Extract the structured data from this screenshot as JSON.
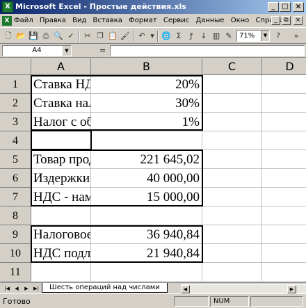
{
  "window": {
    "title": "Microsoft Excel - Простые действия.xls",
    "minimize": "_",
    "maximize": "□",
    "close": "×"
  },
  "menu": {
    "items": [
      "Файл",
      "Правка",
      "Вид",
      "Вставка",
      "Формат",
      "Сервис",
      "Данные",
      "Окно",
      "Справка"
    ],
    "mdi_min": "_",
    "mdi_restore": "⧉",
    "mdi_close": "×"
  },
  "toolbar": {
    "zoom": "71%"
  },
  "formula": {
    "namebox": "A4",
    "eq": "=",
    "value": ""
  },
  "columns": [
    "A",
    "B",
    "C",
    "D"
  ],
  "rows": [
    {
      "num": "1",
      "a": "Ставка НДС",
      "b": "20%"
    },
    {
      "num": "2",
      "a": "Ставка налога на прибыль",
      "b": "30%"
    },
    {
      "num": "3",
      "a": "Налог с оборота",
      "b": "1%"
    },
    {
      "num": "4",
      "a": "",
      "b": ""
    },
    {
      "num": "5",
      "a": "Товар продан",
      "b": "221 645,02"
    },
    {
      "num": "6",
      "a": "Издержки",
      "b": "40 000,00"
    },
    {
      "num": "7",
      "a": "НДС - нами уплаченный",
      "b": "15 000,00"
    },
    {
      "num": "8",
      "a": "",
      "b": ""
    },
    {
      "num": "9",
      "a": "Налоговое бремя",
      "b": "36 940,84"
    },
    {
      "num": "10",
      "a": "НДС подлежащий уплате",
      "b": "21 940,84"
    },
    {
      "num": "11",
      "a": "",
      "b": ""
    }
  ],
  "sheets": {
    "active": "Шесть операций над числами"
  },
  "status": {
    "ready": "Готово",
    "num": "NUM"
  }
}
